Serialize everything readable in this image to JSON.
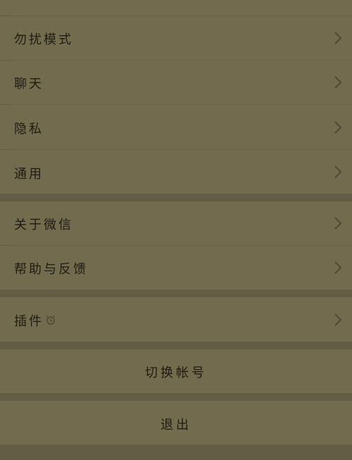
{
  "colors": {
    "background": "#645d46",
    "cell": "#736b4e",
    "text": "#1f1c14",
    "chevron": "#4a4433"
  },
  "settings": {
    "group1": [
      {
        "label": "勿扰模式",
        "icon": "chevron-right-icon"
      },
      {
        "label": "聊天",
        "icon": "chevron-right-icon"
      },
      {
        "label": "隐私",
        "icon": "chevron-right-icon"
      },
      {
        "label": "通用",
        "icon": "chevron-right-icon"
      }
    ],
    "group2": [
      {
        "label": "关于微信",
        "icon": "chevron-right-icon"
      },
      {
        "label": "帮助与反馈",
        "icon": "chevron-right-icon"
      }
    ],
    "group3": [
      {
        "label": "插件",
        "badge_icon": "alarm-clock-icon",
        "icon": "chevron-right-icon"
      }
    ]
  },
  "actions": {
    "switch_account": "切换帐号",
    "logout": "退出"
  }
}
